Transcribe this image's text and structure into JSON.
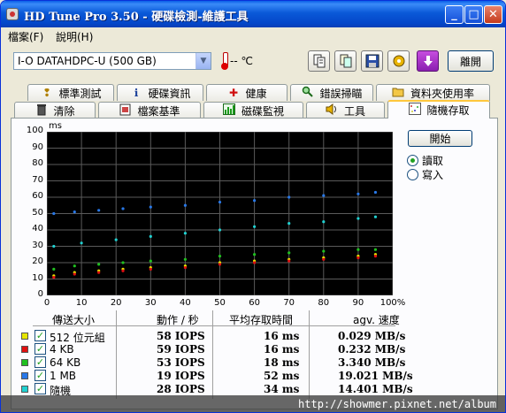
{
  "window": {
    "title": "HD Tune Pro 3.50 - 硬碟檢測-維護工具",
    "minimize_glyph": "_",
    "maximize_glyph": "□",
    "close_glyph": "✕"
  },
  "menu": [
    "檔案(F)",
    "說明(H)"
  ],
  "toolbar": {
    "drive": "I-O DATAHDPC-U (500 GB)",
    "temperature": "-- ",
    "temperature_unit_glyph": "℃",
    "exit_label": "離開",
    "icons": [
      "copy-text-icon",
      "copy-screenshot-icon",
      "save-icon",
      "options-icon",
      "download-icon"
    ]
  },
  "tabs_row1": [
    {
      "label": "標準測試",
      "icon": "info-bulb-icon",
      "glyph": "❢"
    },
    {
      "label": "硬碟資訊",
      "icon": "info-icon",
      "glyph": "ℹ"
    },
    {
      "label": "健康",
      "icon": "health-cross-icon",
      "glyph": "✚"
    },
    {
      "label": "錯誤掃瞄",
      "icon": "magnifier-icon",
      "glyph": "🔍"
    },
    {
      "label": "資料夾使用率",
      "icon": "folder-icon",
      "glyph": "▭"
    }
  ],
  "tabs_row2": [
    {
      "label": "清除",
      "icon": "trash-icon",
      "glyph": "🗑"
    },
    {
      "label": "檔案基準",
      "icon": "file-benchmark-icon",
      "glyph": "▤"
    },
    {
      "label": "磁碟監視",
      "icon": "monitor-chart-icon",
      "glyph": "▥"
    },
    {
      "label": "工具",
      "icon": "speaker-tool-icon",
      "glyph": "◀"
    },
    {
      "label": "隨機存取",
      "icon": "random-access-icon",
      "glyph": "⁙",
      "active": true
    }
  ],
  "controls": {
    "start_label": "開始",
    "read_label": "讀取",
    "write_label": "寫入",
    "selected_mode": "read"
  },
  "colors": {
    "series_512": "#e6e600",
    "series_4k": "#e01010",
    "series_64k": "#20c020",
    "series_1mb": "#2878e8",
    "series_random": "#20d0d0"
  },
  "chart_data": {
    "type": "scatter",
    "ylabel": "ms",
    "ylim": [
      0,
      100
    ],
    "yticks": [
      "0",
      "10",
      "20",
      "30",
      "40",
      "50",
      "60",
      "70",
      "80",
      "90",
      "100"
    ],
    "xlim": [
      0,
      100
    ],
    "xticks": [
      "0",
      "10",
      "20",
      "30",
      "40",
      "50",
      "60",
      "70",
      "80",
      "90",
      "100%"
    ],
    "series": [
      {
        "name": "512 位元組",
        "color": "#e6e600",
        "points": [
          [
            2,
            12
          ],
          [
            8,
            14
          ],
          [
            15,
            15
          ],
          [
            22,
            16
          ],
          [
            30,
            17
          ],
          [
            40,
            18
          ],
          [
            50,
            20
          ],
          [
            60,
            21
          ],
          [
            70,
            22
          ],
          [
            80,
            23
          ],
          [
            90,
            24
          ],
          [
            95,
            25
          ]
        ]
      },
      {
        "name": "4 KB",
        "color": "#e01010",
        "points": [
          [
            2,
            11
          ],
          [
            8,
            13
          ],
          [
            15,
            14
          ],
          [
            22,
            15
          ],
          [
            30,
            16
          ],
          [
            40,
            17
          ],
          [
            50,
            19
          ],
          [
            60,
            20
          ],
          [
            70,
            21
          ],
          [
            80,
            22
          ],
          [
            90,
            23
          ],
          [
            95,
            24
          ]
        ]
      },
      {
        "name": "64 KB",
        "color": "#20c020",
        "points": [
          [
            2,
            16
          ],
          [
            8,
            18
          ],
          [
            15,
            19
          ],
          [
            22,
            20
          ],
          [
            30,
            21
          ],
          [
            40,
            22
          ],
          [
            50,
            24
          ],
          [
            60,
            25
          ],
          [
            70,
            26
          ],
          [
            80,
            27
          ],
          [
            90,
            28
          ],
          [
            95,
            28
          ]
        ]
      },
      {
        "name": "1 MB",
        "color": "#2878e8",
        "points": [
          [
            2,
            50
          ],
          [
            8,
            51
          ],
          [
            15,
            52
          ],
          [
            22,
            53
          ],
          [
            30,
            54
          ],
          [
            40,
            55
          ],
          [
            50,
            57
          ],
          [
            60,
            58
          ],
          [
            70,
            60
          ],
          [
            80,
            61
          ],
          [
            90,
            62
          ],
          [
            95,
            63
          ]
        ]
      },
      {
        "name": "隨機",
        "color": "#20d0d0",
        "points": [
          [
            2,
            30
          ],
          [
            10,
            32
          ],
          [
            20,
            34
          ],
          [
            30,
            36
          ],
          [
            40,
            38
          ],
          [
            50,
            40
          ],
          [
            60,
            42
          ],
          [
            70,
            44
          ],
          [
            80,
            45
          ],
          [
            90,
            47
          ],
          [
            95,
            48
          ]
        ]
      }
    ]
  },
  "results": {
    "headers": [
      "傳送大小",
      "動作 / 秒",
      "平均存取時間",
      "agv. 速度"
    ],
    "rows": [
      {
        "size": "512 位元組",
        "ops": "58 IOPS",
        "access": "16 ms",
        "speed": "0.029 MB/s",
        "color": "#e6e600"
      },
      {
        "size": "4 KB",
        "ops": "59 IOPS",
        "access": "16 ms",
        "speed": "0.232 MB/s",
        "color": "#e01010"
      },
      {
        "size": "64 KB",
        "ops": "53 IOPS",
        "access": "18 ms",
        "speed": "3.340 MB/s",
        "color": "#20c020"
      },
      {
        "size": "1 MB",
        "ops": "19 IOPS",
        "access": "52 ms",
        "speed": "19.021 MB/s",
        "color": "#2878e8"
      },
      {
        "size": "隨機",
        "ops": "28 IOPS",
        "access": "34 ms",
        "speed": "14.401 MB/s",
        "color": "#20d0d0"
      }
    ],
    "checkmark": "✓"
  },
  "watermark": "http://showmer.pixnet.net/album"
}
